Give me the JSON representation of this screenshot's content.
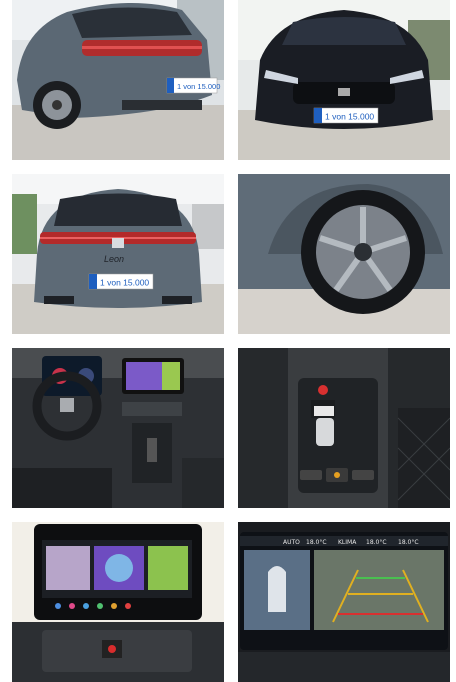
{
  "gallery": {
    "plate_text": "1 von 15.000",
    "rear_badge": "Leon",
    "screen": {
      "auto": "AUTO",
      "temp_left": "18.0°C",
      "klima": "KLIMA",
      "temp_right": "18.0°C",
      "temp_right2": "18.0°C"
    },
    "colors": {
      "body_grey": "#5d6a76",
      "body_black": "#1a1d24",
      "plate_blue": "#1f5fbf"
    }
  }
}
